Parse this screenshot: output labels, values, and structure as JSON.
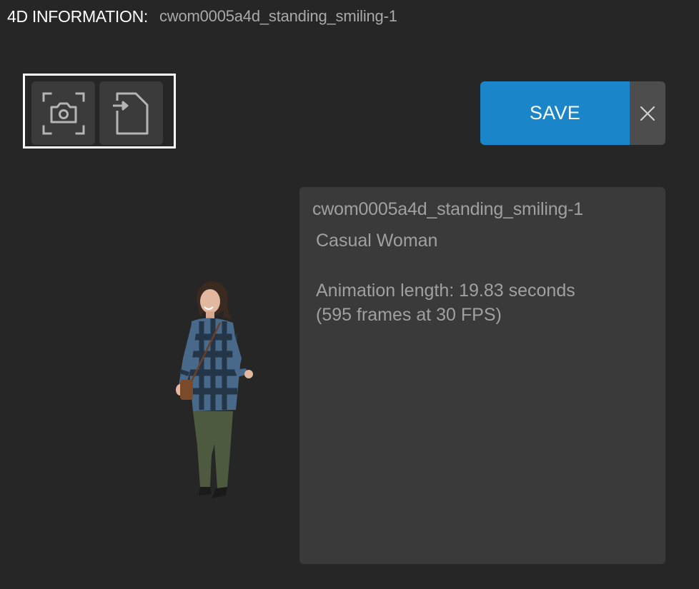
{
  "header": {
    "label": "4D INFORMATION:",
    "name": "cwom0005a4d_standing_smiling-1"
  },
  "toolbar": {
    "snapshot_icon": "camera-frame-icon",
    "import_icon": "file-import-icon"
  },
  "actions": {
    "save_label": "SAVE",
    "close_icon": "close-icon",
    "save_color": "#1a85c8"
  },
  "info": {
    "title": "cwom0005a4d_standing_smiling-1",
    "subtitle": "Casual Woman",
    "length": "Animation length: 19.83 seconds",
    "frames": "(595 frames at 30 FPS)"
  }
}
